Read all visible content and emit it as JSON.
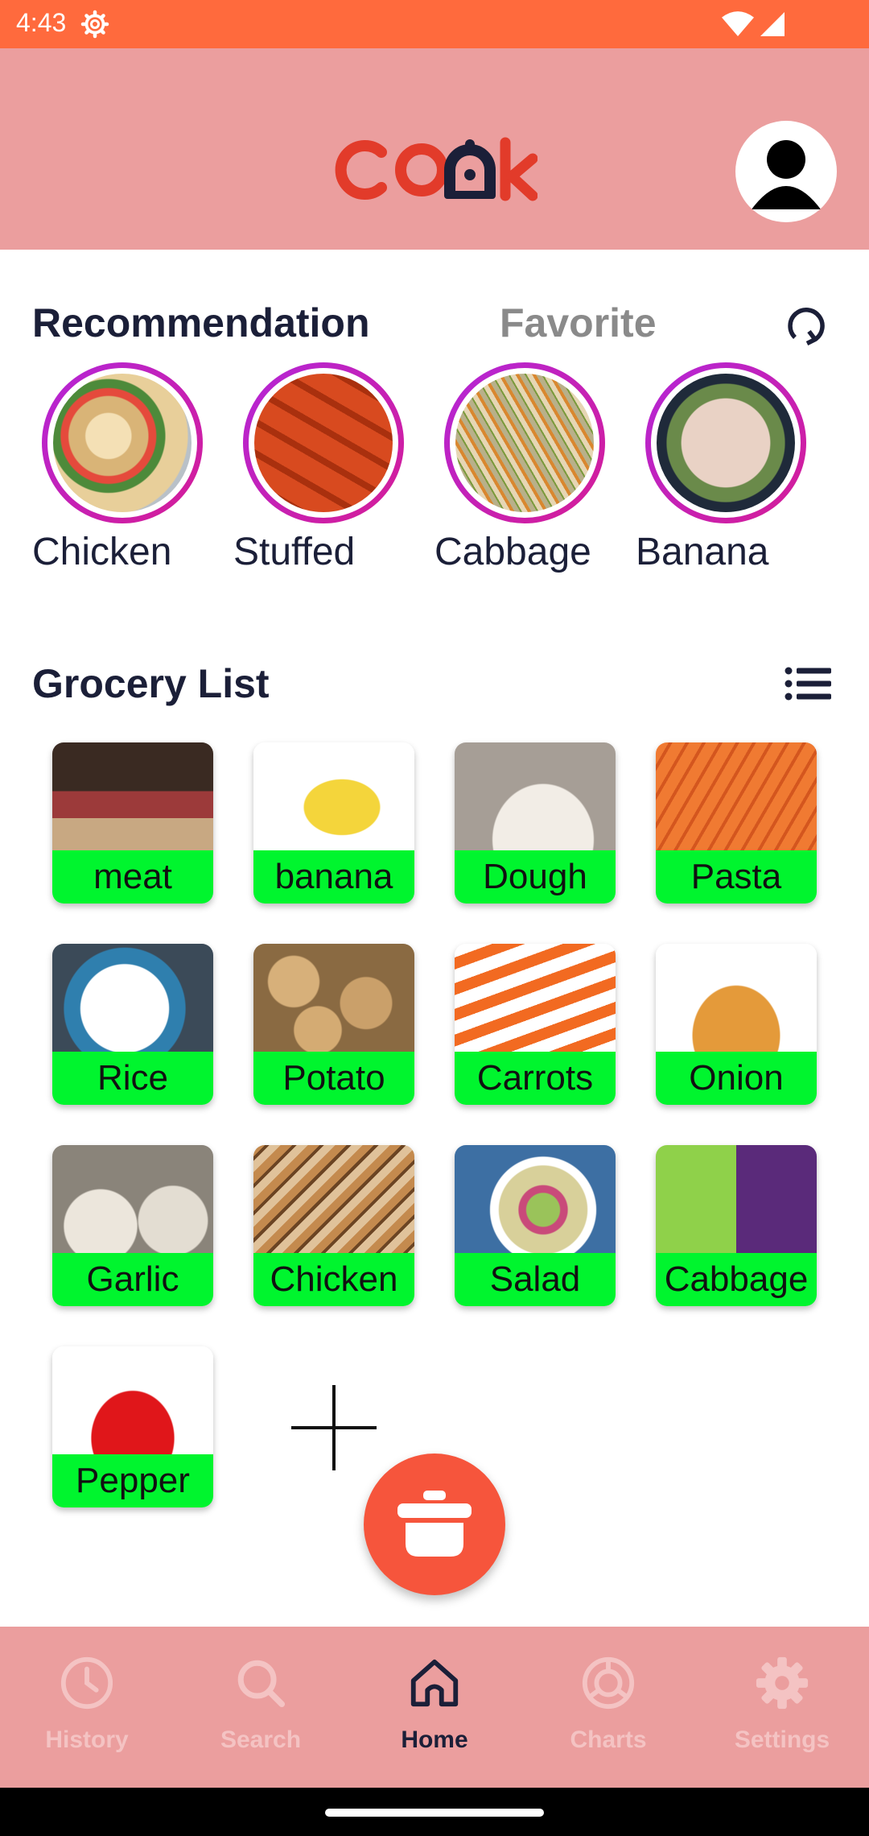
{
  "status_bar": {
    "time": "4:43"
  },
  "header": {
    "logo_text": "coOk"
  },
  "tabs": {
    "recommendation": "Recommendation",
    "favorite": "Favorite"
  },
  "recommendations": [
    {
      "label": "Chicken"
    },
    {
      "label": "Stuffed"
    },
    {
      "label": "Cabbage"
    },
    {
      "label": "Banana"
    }
  ],
  "grocery": {
    "title": "Grocery List",
    "items": [
      {
        "label": "meat"
      },
      {
        "label": "banana"
      },
      {
        "label": "Dough"
      },
      {
        "label": "Pasta"
      },
      {
        "label": "Rice"
      },
      {
        "label": "Potato"
      },
      {
        "label": "Carrots"
      },
      {
        "label": "Onion"
      },
      {
        "label": "Garlic"
      },
      {
        "label": "Chicken"
      },
      {
        "label": "Salad"
      },
      {
        "label": "Cabbage"
      },
      {
        "label": "Pepper"
      }
    ]
  },
  "bottom_nav": [
    {
      "label": "History",
      "icon": "clock-icon"
    },
    {
      "label": "Search",
      "icon": "search-icon"
    },
    {
      "label": "Home",
      "icon": "home-icon"
    },
    {
      "label": "Charts",
      "icon": "chart-icon"
    },
    {
      "label": "Settings",
      "icon": "gear-icon"
    }
  ],
  "colors": {
    "status_bar": "#ff6a3d",
    "header": "#eb9e9e",
    "accent": "#f6553c",
    "label_green": "#00f52e",
    "nav_active": "#1b1f38",
    "nav_inactive": "#f4c3c3"
  }
}
